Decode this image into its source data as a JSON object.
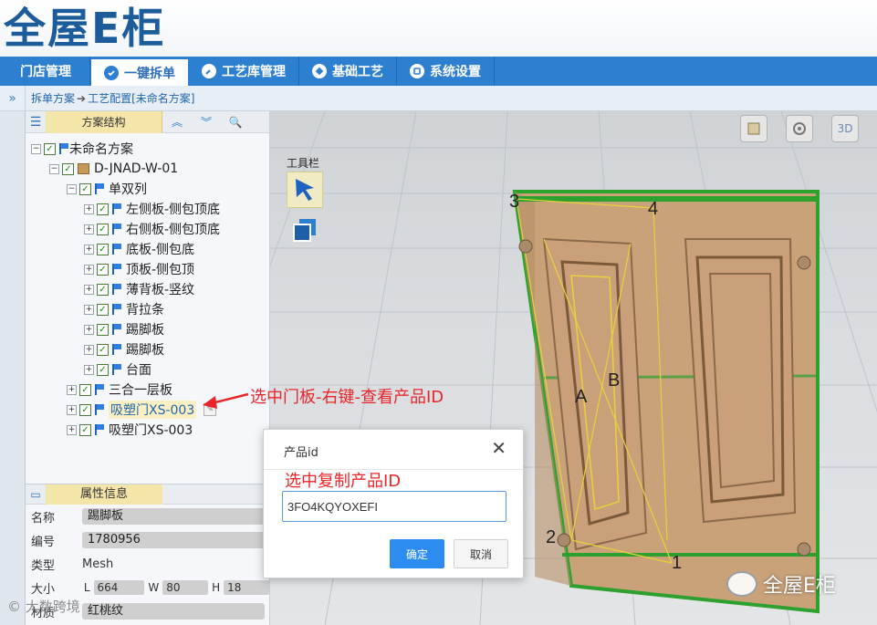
{
  "app": {
    "logo_text": "全屋E柜"
  },
  "nav": {
    "items": [
      {
        "label": "门店管理",
        "active": false
      },
      {
        "label": "一键拆单",
        "active": true
      },
      {
        "label": "工艺库管理",
        "active": false
      },
      {
        "label": "基础工艺",
        "active": false
      },
      {
        "label": "系统设置",
        "active": false
      }
    ]
  },
  "breadcrumb": {
    "toggle_glyph": "»",
    "part1": "拆单方案",
    "arrow": "➔",
    "part2": "工艺配置[未命名方案]"
  },
  "tree_panel": {
    "title": "方案结构",
    "btn_up": "︽",
    "btn_down": "︾",
    "btn_search": "🔍",
    "rows": [
      {
        "label": "未命名方案"
      },
      {
        "label": "D-JNAD-W-01"
      },
      {
        "label": "单双列"
      },
      {
        "label": "左侧板-侧包顶底"
      },
      {
        "label": "右侧板-侧包顶底"
      },
      {
        "label": "底板-侧包底"
      },
      {
        "label": "顶板-侧包顶"
      },
      {
        "label": "薄背板-竖纹"
      },
      {
        "label": "背拉条"
      },
      {
        "label": "踢脚板"
      },
      {
        "label": "踢脚板"
      },
      {
        "label": "台面"
      },
      {
        "label": "三合一层板"
      },
      {
        "label": "吸塑门XS-003",
        "selected": true
      },
      {
        "label": "吸塑门XS-003"
      }
    ]
  },
  "prop_panel": {
    "title": "属性信息",
    "name_key": "名称",
    "name_val": "踢脚板",
    "code_key": "编号",
    "code_val": "1780956",
    "type_key": "类型",
    "type_val": "Mesh",
    "size_key": "大小",
    "size_l_label": "L",
    "size_l": "664",
    "size_w_label": "W",
    "size_w": "80",
    "size_h_label": "H",
    "size_h": "18",
    "material_key": "材质",
    "material_val": "红桃纹"
  },
  "viewport": {
    "toolbar_label": "工具栏",
    "view_icons": [
      "cabinet-view-icon",
      "camera-view-icon",
      "3d-view-icon"
    ],
    "label_3d": "3D",
    "labels": {
      "p1": "1",
      "p2": "2",
      "p3": "3",
      "p4": "4",
      "pa": "A",
      "pb": "B"
    },
    "colors": {
      "cabinet_wood": "#c9a27a",
      "highlight_green": "#2ea02e",
      "edge_yellow": "#e6d23a"
    }
  },
  "dialog": {
    "title": "产品id",
    "close_glyph": "✕",
    "input_value": "3FO4KQYOXEFI",
    "ok_label": "确定",
    "cancel_label": "取消"
  },
  "annotations": {
    "note1": "选中门板-右键-查看产品ID",
    "note2": "选中复制产品ID",
    "color": "#e8262a"
  },
  "watermarks": {
    "wechat": "全屋E柜",
    "corner": "© 大数跨境"
  }
}
